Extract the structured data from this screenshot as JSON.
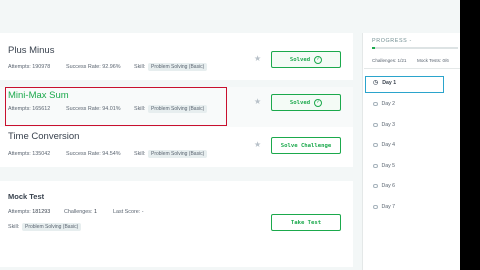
{
  "challenges": [
    {
      "title": "Plus Minus",
      "attempts": "Attempts: 190978",
      "success_rate": "Success Rate: 92.96%",
      "skill_label": "Skill:",
      "skill": "Problem Solving (Basic)",
      "button": "Solved"
    },
    {
      "title": "Mini-Max Sum",
      "attempts": "Attempts: 165612",
      "success_rate": "Success Rate: 94.01%",
      "skill_label": "Skill:",
      "skill": "Problem Solving (Basic)",
      "button": "Solved"
    },
    {
      "title": "Time Conversion",
      "attempts": "Attempts: 135042",
      "success_rate": "Success Rate: 94.54%",
      "skill_label": "Skill:",
      "skill": "Problem Solving (Basic)",
      "button": "Solve Challenge"
    }
  ],
  "mock_test": {
    "title": "Mock Test",
    "attempts_label": "Attempts:",
    "attempts": "181293",
    "challenges_label": "Challenges:",
    "challenges": "1",
    "last_score": "Last Score: -",
    "skill_label": "Skill:",
    "skill": "Problem Solving (Basic)",
    "button": "Take Test"
  },
  "progress": {
    "heading": "PROGRESS -",
    "fraction": 0.03,
    "challenges": "Challenges: 1/21",
    "mock_tests": "Mock Tests: 0/6",
    "days": [
      "Day 1",
      "Day 2",
      "Day 3",
      "Day 4",
      "Day 5",
      "Day 6",
      "Day 7"
    ]
  },
  "icons": {
    "star": "star-icon",
    "check": "check-circle-icon",
    "day": "circle-icon",
    "clock": "clock-icon"
  },
  "colors": {
    "accent_green": "#1ba94c",
    "highlight_red": "#c8102e",
    "highlight_blue": "#2ba4cc"
  }
}
